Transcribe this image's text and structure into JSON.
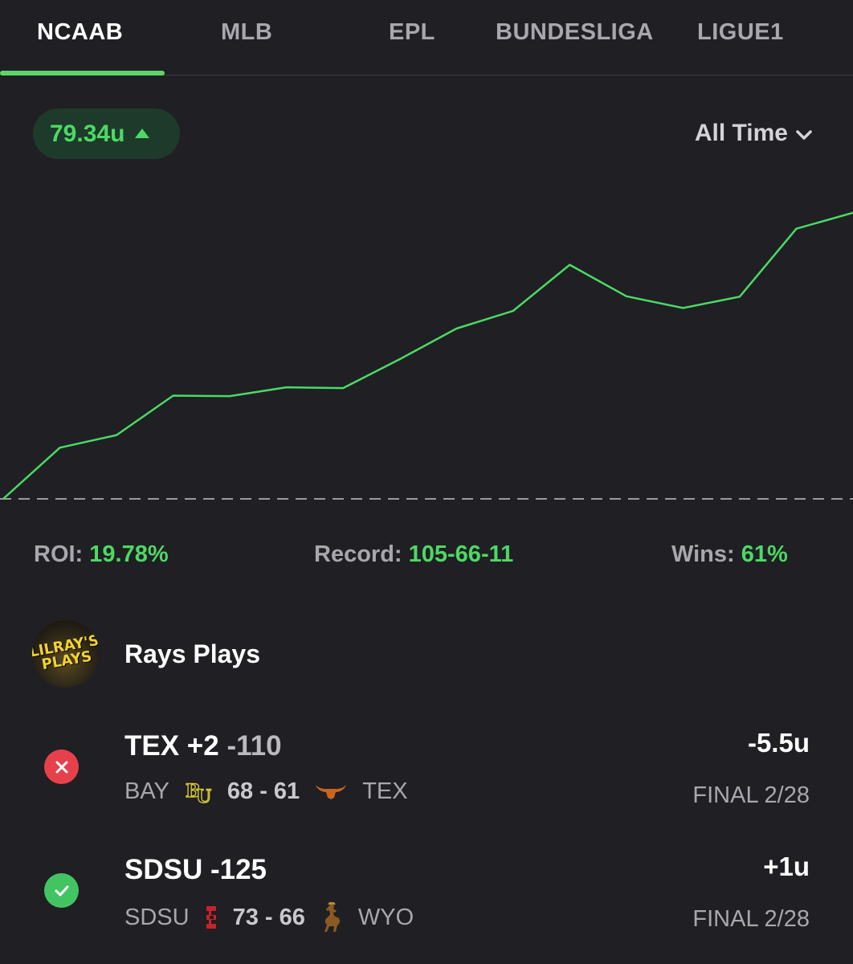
{
  "tabs": [
    {
      "label": "NCAAB",
      "active": true
    },
    {
      "label": "MLB",
      "active": false
    },
    {
      "label": "EPL",
      "active": false
    },
    {
      "label": "BUNDESLIGA",
      "active": false
    },
    {
      "label": "LIGUE1",
      "active": false
    }
  ],
  "summary": {
    "units": "79.34u",
    "trend_icon": "triangle-up-icon",
    "range_label": "All Time"
  },
  "chart_data": {
    "type": "line",
    "title": "",
    "xlabel": "",
    "ylabel": "",
    "grid": false,
    "baseline": 0,
    "baseline_style": "dashed",
    "x": [
      0,
      1,
      2,
      3,
      4,
      5,
      6,
      7,
      8,
      9,
      10,
      11,
      12,
      13,
      14,
      15
    ],
    "series": [
      {
        "values": [
          0.0,
          12.2,
          15.2,
          24.6,
          24.5,
          26.6,
          26.4,
          33.3,
          40.6,
          44.8,
          55.8,
          48.3,
          45.5,
          48.2,
          64.4,
          68.2
        ]
      }
    ],
    "ylim": [
      0,
      72
    ],
    "line_color": "#4cd964",
    "baseline_color": "#9a9aa0"
  },
  "stats": {
    "roi_label": "ROI:",
    "roi_value": "19.78%",
    "record_label": "Record:",
    "record_value": "105-66-11",
    "wins_label": "Wins:",
    "wins_value": "61%"
  },
  "author": {
    "name": "Rays Plays",
    "avatar_icon": "lilrays-plays-logo-icon"
  },
  "bets": [
    {
      "pick": "TEX +2",
      "odds": "-110",
      "result": "loss",
      "result_icon": "x-circle-icon",
      "away": "BAY",
      "away_logo": "baylor-bu-logo-icon",
      "score": "68 - 61",
      "home_logo": "longhorn-logo-icon",
      "home": "TEX",
      "units": "-5.5u",
      "final": "FINAL 2/28"
    },
    {
      "pick": "SDSU -125",
      "odds": "",
      "result": "win",
      "result_icon": "check-circle-icon",
      "away": "SDSU",
      "away_logo": "sdsu-logo-icon",
      "score": "73 - 66",
      "home_logo": "wyoming-cowboy-logo-icon",
      "home": "WYO",
      "units": "+1u",
      "final": "FINAL 2/28"
    }
  ],
  "colors": {
    "background": "#1f1f24",
    "accent_green": "#4cd964",
    "loss_red": "#e6414b"
  }
}
